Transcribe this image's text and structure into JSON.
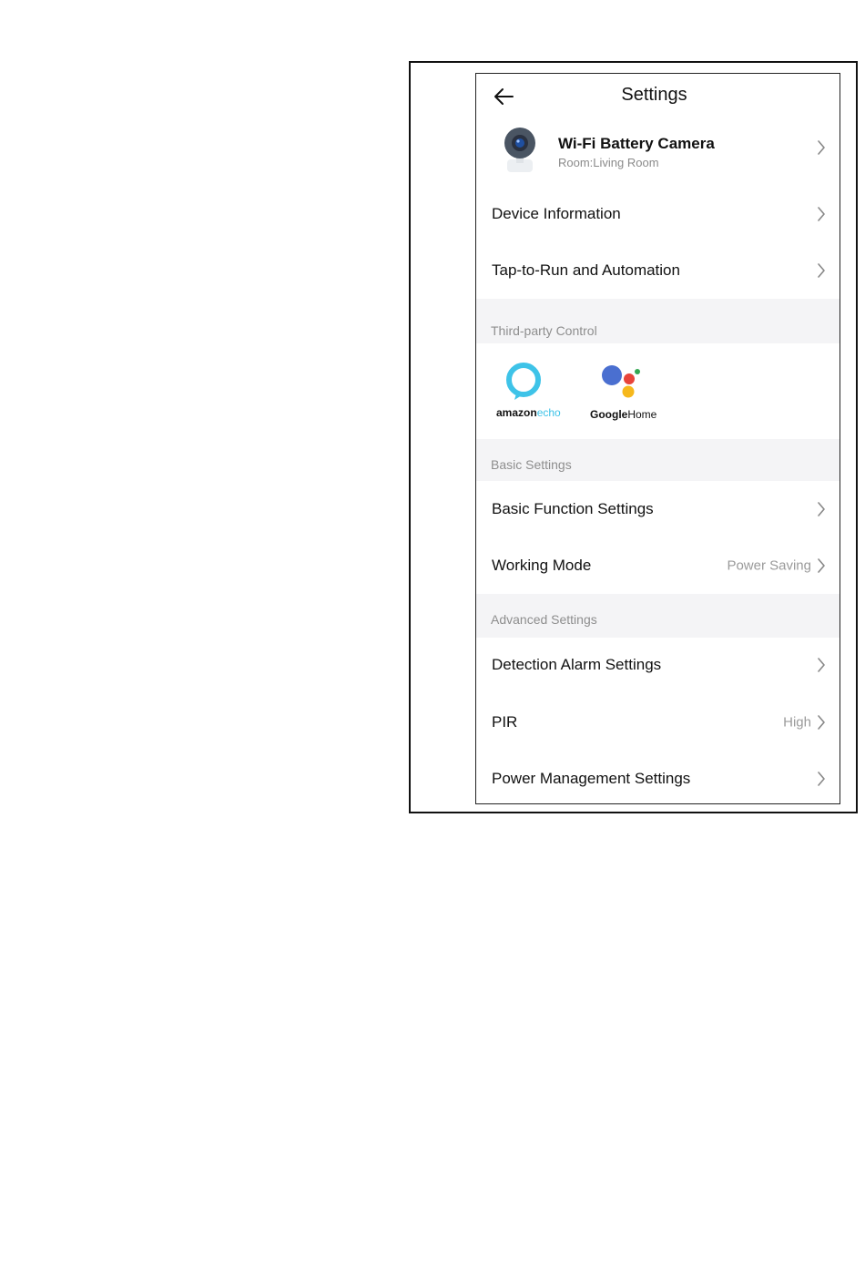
{
  "header": {
    "title": "Settings",
    "back_icon": "back-arrow-icon"
  },
  "device": {
    "name": "Wi-Fi Battery Camera",
    "room": "Room:Living Room",
    "icon": "camera-icon"
  },
  "rows_top": [
    {
      "label": "Device Information"
    },
    {
      "label": "Tap-to-Run and Automation"
    }
  ],
  "sections": {
    "third_party": "Third-party Control",
    "basic": "Basic Settings",
    "advanced": "Advanced Settings"
  },
  "third_party": {
    "amazon": {
      "brand": "amazon",
      "product": "echo",
      "icon": "amazon-echo-icon"
    },
    "google": {
      "brand": "Google",
      "product": "Home",
      "icon": "google-home-icon"
    }
  },
  "basic_rows": [
    {
      "label": "Basic Function Settings",
      "value": ""
    },
    {
      "label": "Working Mode",
      "value": "Power Saving"
    }
  ],
  "advanced_rows": [
    {
      "label": "Detection Alarm Settings",
      "value": ""
    },
    {
      "label": "PIR",
      "value": "High"
    },
    {
      "label": "Power Management Settings",
      "value": ""
    }
  ],
  "colors": {
    "echo_blue": "#3ec3e8",
    "google_blue": "#4a6fd0",
    "google_red": "#e8443a",
    "google_yellow": "#f6b81c",
    "google_green": "#34a853",
    "section_bg": "#f4f4f6"
  }
}
